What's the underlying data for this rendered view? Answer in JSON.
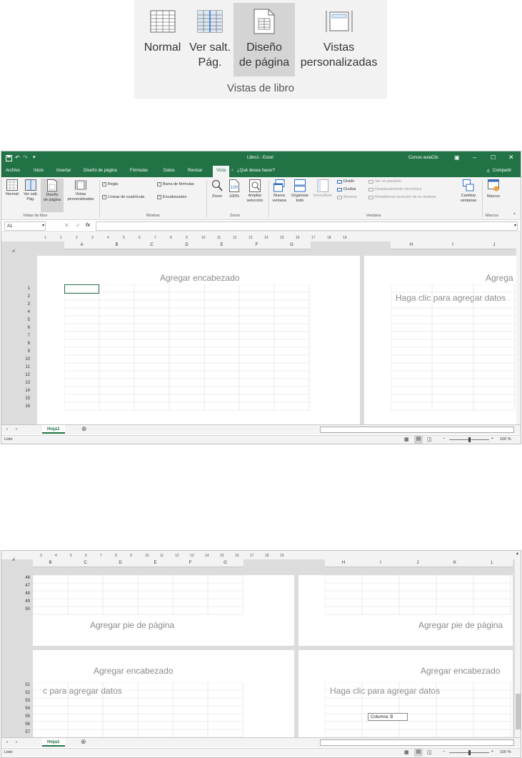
{
  "zoom_group": {
    "buttons": [
      {
        "label": "Normal",
        "icon": "normal-view-icon"
      },
      {
        "label": "Ver salt.\nPág.",
        "icon": "page-break-preview-icon"
      },
      {
        "label": "Diseño\nde página",
        "icon": "page-layout-icon"
      },
      {
        "label": "Vistas\npersonalizadas",
        "icon": "custom-views-icon"
      }
    ],
    "group_label": "Vistas de libro"
  },
  "window": {
    "title": "Libro1 - Excel",
    "user": "Cursos aulaClic",
    "share": "Compartir",
    "menu": [
      "Archivo",
      "Inicio",
      "Insertar",
      "Diseño de página",
      "Fórmulas",
      "Datos",
      "Revisar",
      "Vista"
    ],
    "tell_me": "¿Qué desea hacer?"
  },
  "ribbon": {
    "views": [
      {
        "label": "Normal"
      },
      {
        "label": "Ver salt.\nPág."
      },
      {
        "label": "Diseño\nde página"
      },
      {
        "label": "Vistas\npersonalizadas"
      }
    ],
    "views_group": "Vistas de libro",
    "show": {
      "ruler": "Regla",
      "formula_bar": "Barra de fórmulas",
      "gridlines": "Líneas de cuadrícula",
      "headings": "Encabezados",
      "group": "Mostrar"
    },
    "zoom": {
      "zoom": "Zoom",
      "hundred": "100%",
      "selection": "Ampliar\nselección",
      "group": "Zoom"
    },
    "window": {
      "new": "Nueva\nventana",
      "arrange": "Organizar\ntodo",
      "freeze": "Inmovilizar",
      "split": "Dividir",
      "hide": "Ocultar",
      "unhide": "Mostrar",
      "side_by_side": "Ver en paralelo",
      "sync_scroll": "Desplazamiento sincrónico",
      "reset": "Restablecer posición de la ventana",
      "switch": "Cambiar\nventanas",
      "group": "Ventana"
    },
    "macros": {
      "label": "Macros",
      "group": "Macros"
    }
  },
  "formula_bar": {
    "name_box": "A1",
    "fx": "fx"
  },
  "sheet1": {
    "ruler": [
      "1",
      "1",
      "2",
      "3",
      "4",
      "5",
      "6",
      "7",
      "8",
      "9",
      "10",
      "11",
      "12",
      "13",
      "14",
      "15",
      "16",
      "17",
      "18",
      "19"
    ],
    "columns_left": [
      "A",
      "B",
      "C",
      "D",
      "E",
      "F",
      "G"
    ],
    "columns_right": [
      "H",
      "I",
      "J"
    ],
    "header_left": "Agregar encabezado",
    "header_right": "Agrega",
    "click_right": "Haga clic para agregar datos",
    "rows": [
      "1",
      "2",
      "3",
      "4",
      "5",
      "6",
      "7",
      "8",
      "9",
      "10",
      "11",
      "12",
      "13",
      "14",
      "15",
      "16"
    ]
  },
  "sheet2": {
    "ruler": [
      "3",
      "4",
      "5",
      "6",
      "7",
      "8",
      "9",
      "10",
      "11",
      "12",
      "13",
      "14",
      "15",
      "16",
      "17",
      "18",
      "19"
    ],
    "columns_left": [
      "B",
      "C",
      "D",
      "E",
      "F",
      "G"
    ],
    "columns_right": [
      "H",
      "I",
      "J",
      "K",
      "L"
    ],
    "rows_top": [
      "46",
      "47",
      "48",
      "49",
      "50"
    ],
    "footer_left": "Agregar pie de página",
    "footer_right": "Agregar pie de página",
    "header_left": "Agregar encabezado",
    "header_right": "Agregar encabezado",
    "click_left": "c para agregar datos",
    "click_right": "Haga clic para agregar datos",
    "rows_bottom": [
      "51",
      "52",
      "53",
      "54",
      "55",
      "56",
      "57"
    ],
    "tooltip": "Columna: B"
  },
  "tabbar": {
    "sheet": "Hoja1"
  },
  "statusbar": {
    "ready": "Listo",
    "zoom": "100 %"
  },
  "colors": {
    "accent": "#217346",
    "ribbon": "#f3f3f3",
    "selected": "#d4d4d4"
  }
}
